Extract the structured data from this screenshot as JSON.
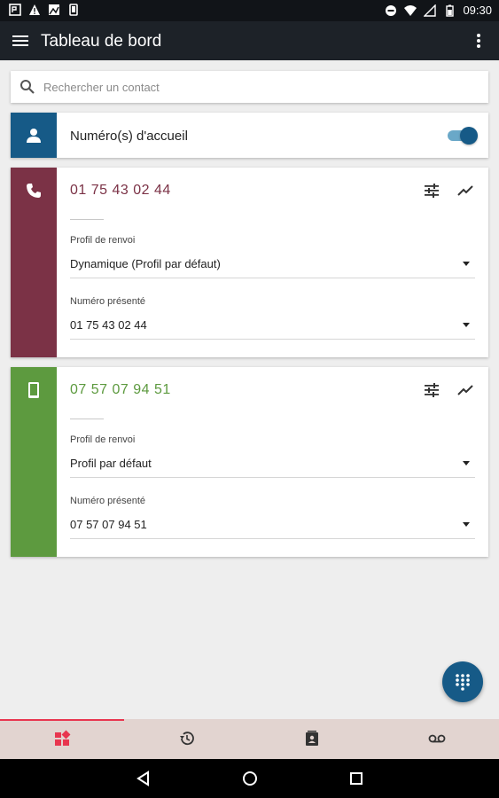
{
  "status_bar": {
    "time": "09:30",
    "left_icons": [
      "app-notification-icon",
      "warning-icon",
      "image-icon",
      "phone-icon"
    ],
    "right_icons": [
      "do-not-disturb-icon",
      "wifi-icon",
      "signal-icon",
      "battery-icon"
    ]
  },
  "app_bar": {
    "title": "Tableau de bord",
    "menu_icon": "menu-icon",
    "more_icon": "more-vert-icon"
  },
  "search": {
    "placeholder": "Rechercher un contact",
    "icon": "search-icon"
  },
  "accueil": {
    "label": "Numéro(s) d'accueil",
    "icon": "person-icon",
    "toggle_on": true,
    "color": "#165a87"
  },
  "lines": [
    {
      "number": "01 75 43 02 44",
      "icon": "phone-icon",
      "color": "#7b3246",
      "profil_label": "Profil de renvoi",
      "profil_value": "Dynamique (Profil par défaut)",
      "presente_label": "Numéro présenté",
      "presente_value": "01 75 43 02 44"
    },
    {
      "number": "07 57 07 94 51",
      "icon": "smartphone-icon",
      "color": "#5d9a3f",
      "profil_label": "Profil de renvoi",
      "profil_value": "Profil par défaut",
      "presente_label": "Numéro présenté",
      "presente_value": "07 57 07 94 51"
    }
  ],
  "fab": {
    "icon": "dialpad-icon",
    "color": "#165a87"
  },
  "bottom_nav": {
    "active_index": 0,
    "accent": "#e8364f",
    "tabs": [
      "dashboard-icon",
      "history-icon",
      "contacts-icon",
      "voicemail-icon"
    ]
  },
  "system_nav": [
    "back-icon",
    "home-icon",
    "recents-icon"
  ]
}
